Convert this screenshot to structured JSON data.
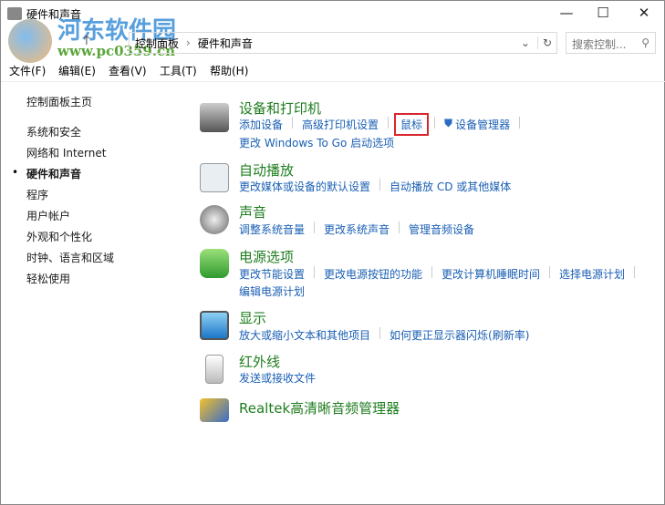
{
  "window": {
    "title": "硬件和声音",
    "minimize": "—",
    "maximize": "☐",
    "close": "✕"
  },
  "watermark": {
    "name": "河东软件园",
    "url": "www.pc0359.cn"
  },
  "address": {
    "crumbs": [
      "控制面板",
      "硬件和声音"
    ],
    "search_placeholder": "搜索控制..."
  },
  "menu": [
    "文件(F)",
    "编辑(E)",
    "查看(V)",
    "工具(T)",
    "帮助(H)"
  ],
  "sidebar": {
    "home": "控制面板主页",
    "items": [
      "系统和安全",
      "网络和 Internet",
      "硬件和声音",
      "程序",
      "用户帐户",
      "外观和个性化",
      "时钟、语言和区域",
      "轻松使用"
    ],
    "active": "硬件和声音"
  },
  "sections": [
    {
      "title": "设备和打印机",
      "rows": [
        [
          "添加设备",
          "高级打印机设置",
          "鼠标",
          "设备管理器"
        ],
        [
          "更改 Windows To Go 启动选项"
        ]
      ]
    },
    {
      "title": "自动播放",
      "rows": [
        [
          "更改媒体或设备的默认设置",
          "自动播放 CD 或其他媒体"
        ]
      ]
    },
    {
      "title": "声音",
      "rows": [
        [
          "调整系统音量",
          "更改系统声音",
          "管理音频设备"
        ]
      ]
    },
    {
      "title": "电源选项",
      "rows": [
        [
          "更改节能设置",
          "更改电源按钮的功能",
          "更改计算机睡眠时间",
          "选择电源计划"
        ],
        [
          "编辑电源计划"
        ]
      ]
    },
    {
      "title": "显示",
      "rows": [
        [
          "放大或缩小文本和其他项目",
          "如何更正显示器闪烁(刷新率)"
        ]
      ]
    },
    {
      "title": "红外线",
      "rows": [
        [
          "发送或接收文件"
        ]
      ]
    },
    {
      "title": "Realtek高清晰音频管理器",
      "rows": []
    }
  ],
  "highlight": "鼠标"
}
